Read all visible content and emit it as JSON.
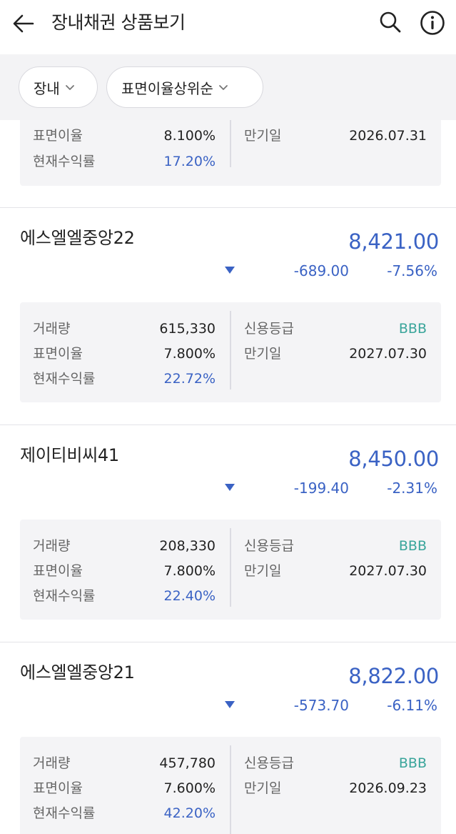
{
  "header": {
    "title": "장내채권 상품보기"
  },
  "filters": {
    "market": "장내",
    "sort": "표면이율상위순"
  },
  "partial_item": {
    "coupon_label": "표면이율",
    "coupon": "8.100%",
    "current_yield_label": "현재수익률",
    "current_yield": "17.20%",
    "maturity_label": "만기일",
    "maturity": "2026.07.31"
  },
  "items": [
    {
      "name": "에스엘엘중앙22",
      "price": "8,421.00",
      "change": "-689.00",
      "rate": "-7.56%",
      "volume_label": "거래량",
      "volume": "615,330",
      "coupon_label": "표면이율",
      "coupon": "7.800%",
      "current_yield_label": "현재수익률",
      "current_yield": "22.72%",
      "rating_label": "신용등급",
      "rating": "BBB",
      "maturity_label": "만기일",
      "maturity": "2027.07.30"
    },
    {
      "name": "제이티비씨41",
      "price": "8,450.00",
      "change": "-199.40",
      "rate": "-2.31%",
      "volume_label": "거래량",
      "volume": "208,330",
      "coupon_label": "표면이율",
      "coupon": "7.800%",
      "current_yield_label": "현재수익률",
      "current_yield": "22.40%",
      "rating_label": "신용등급",
      "rating": "BBB",
      "maturity_label": "만기일",
      "maturity": "2027.07.30"
    },
    {
      "name": "에스엘엘중앙21",
      "price": "8,822.00",
      "change": "-573.70",
      "rate": "-6.11%",
      "volume_label": "거래량",
      "volume": "457,780",
      "coupon_label": "표면이율",
      "coupon": "7.600%",
      "current_yield_label": "현재수익률",
      "current_yield": "42.20%",
      "rating_label": "신용등급",
      "rating": "BBB",
      "maturity_label": "만기일",
      "maturity": "2026.09.23"
    }
  ],
  "colors": {
    "accent_blue": "#3a62c4",
    "rating_green": "#3aa59b"
  },
  "icons": {
    "back": "back-arrow-icon",
    "search": "search-icon",
    "info": "info-icon",
    "chevron": "chevron-down-icon",
    "down": "down-triangle-icon"
  }
}
